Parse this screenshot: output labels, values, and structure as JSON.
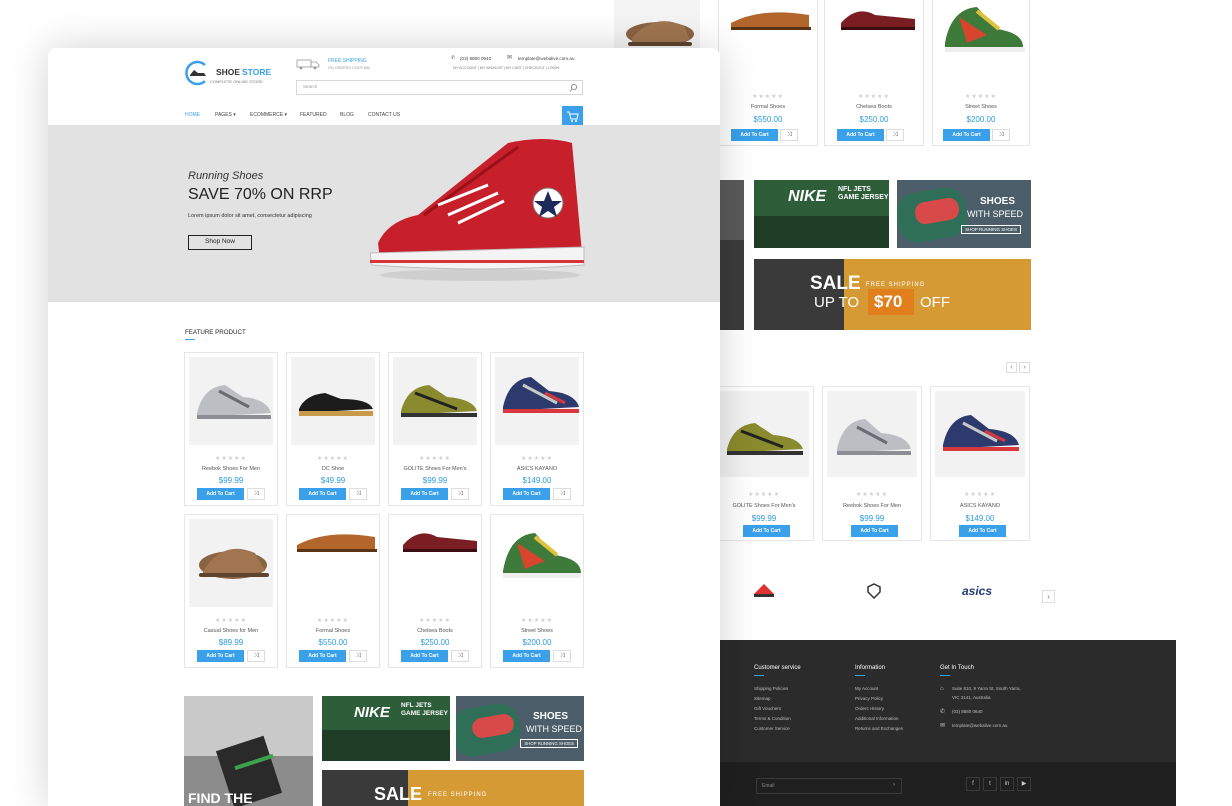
{
  "brand": {
    "name_a": "SHOE",
    "name_b": "STORE",
    "tagline": "COMPLETE ONLINE STORE"
  },
  "header": {
    "shipping_title": "FREE SHIPPING",
    "shipping_sub": "ON ORDERS OVER $50",
    "phone": "(03) 8880 0640",
    "email": "template@webalive.com.au",
    "account_links": "MY ACCOUNT | MY WISHLIST | MY CART | CHECKOUT | LOGIN",
    "search_placeholder": "Search"
  },
  "nav": {
    "home": "HOME",
    "pages": "PAGES ▾",
    "ecommerce": "ECOMMERCE ▾",
    "featured": "FEATURED",
    "blog": "BLOG",
    "contact": "CONTACT US"
  },
  "hero": {
    "kicker": "Running Shoes",
    "headline": "SAVE 70% ON RRP",
    "body": "Lorem ipsum dolor sit amet, consectetur adipiscing",
    "cta": "Shop Now"
  },
  "feature": {
    "title": "FEATURE PRODUCT"
  },
  "common": {
    "add_to_cart": "Add To Cart",
    "compare_icon": "shuffle-icon",
    "stars": "★★★★★"
  },
  "front_products": [
    {
      "name": "Reebok Shoes For Men",
      "price": "$99.99"
    },
    {
      "name": "DC Shoe",
      "price": "$49.99"
    },
    {
      "name": "GOLITE Shoes For Men's",
      "price": "$99.99"
    },
    {
      "name": "ASICS KAYANO",
      "price": "$149.00"
    },
    {
      "name": "Casual Shoes for Men",
      "price": "$89.99"
    },
    {
      "name": "Formal Shoes",
      "price": "$550.00"
    },
    {
      "name": "Chelsea Boots",
      "price": "$250.00"
    },
    {
      "name": "Street Shoes",
      "price": "$200.00"
    }
  ],
  "back_top_products": [
    {
      "name": "Formal Shoes",
      "price": "$550.00"
    },
    {
      "name": "Chelsea Boots",
      "price": "$250.00"
    },
    {
      "name": "Street Shoes",
      "price": "$200.00"
    }
  ],
  "back_bottom_products": [
    {
      "name": "GOLITE Shoes For Men's",
      "price": "$99.99"
    },
    {
      "name": "Reebok Shoes For Men",
      "price": "$99.99"
    },
    {
      "name": "ASICS KAYANO",
      "price": "$149.00"
    }
  ],
  "banners": {
    "nike_a": "NIKE",
    "nike_b": "NFL JETS",
    "nike_c": "GAME JERSEY",
    "speed_a": "SHOES",
    "speed_b": "WITH SPEED",
    "speed_btn": "SHOP RUNNING SHOES",
    "sale_a": "SALE",
    "sale_b": "FREE SHIPPING",
    "sale_c": "UP TO",
    "sale_d": "$70",
    "sale_e": "OFF",
    "find": "FIND THE"
  },
  "brands": {
    "asics": "asics"
  },
  "footer": {
    "cs_title": "Customer service",
    "cs_links": [
      "Shipping Policies",
      "Sitemap",
      "Gift Vouchers",
      "Terms & Condition",
      "Customer Service"
    ],
    "info_title": "Information",
    "info_links": [
      "My Account",
      "Privacy Policy",
      "Orders History",
      "Additional Information",
      "Returns and Exchanges"
    ],
    "touch_title": "Get In Touch",
    "address_a": "Suite 810, 9 Yarra St, South Yarra,",
    "address_b": "VIC 3141, Australia",
    "phone": "(03) 8880 0640",
    "email": "template@webalive.com.au",
    "email_placeholder": "Email"
  },
  "colors": {
    "accent": "#3aa0ea",
    "footer_bg": "#2b2b2b",
    "hero_bg": "#e2e2e2"
  }
}
